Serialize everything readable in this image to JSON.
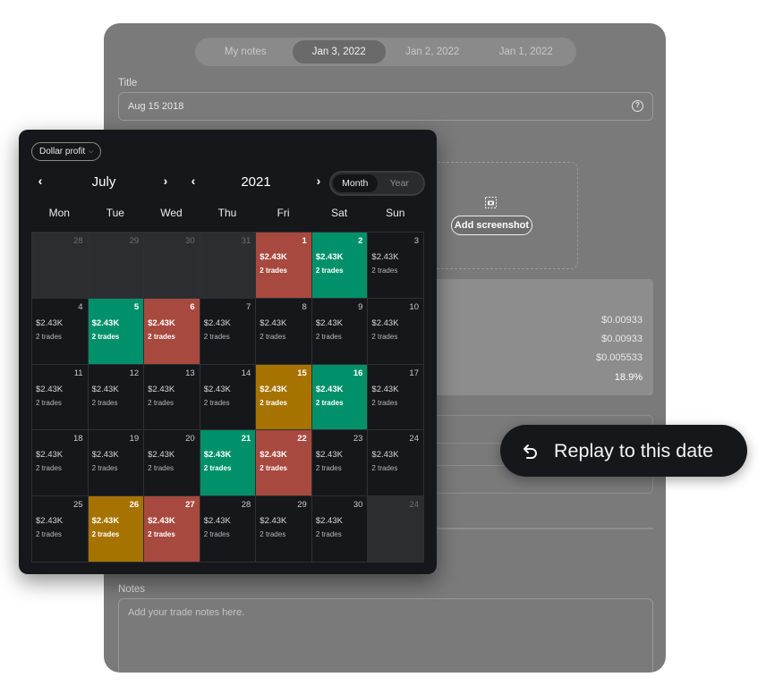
{
  "notes_panel": {
    "tabs": [
      {
        "label": "My notes",
        "active": false
      },
      {
        "label": "Jan 3, 2022",
        "active": true
      },
      {
        "label": "Jan 2, 2022",
        "active": false
      },
      {
        "label": "Jan 1, 2022",
        "active": false
      }
    ],
    "title_label": "Title",
    "title_value": "Aug 15 2018",
    "add_screenshot_label": "Add screenshot",
    "stats": [
      "$0.00933",
      "$0.00933",
      "$0.005533",
      "18.9%"
    ],
    "notes_label": "Notes",
    "notes_placeholder": "Add your trade notes here."
  },
  "calendar": {
    "metric_dropdown": "Dollar profit",
    "month": "July",
    "year": "2021",
    "view_toggle": [
      {
        "label": "Month",
        "active": true
      },
      {
        "label": "Year",
        "active": false
      }
    ],
    "weekdays": [
      "Mon",
      "Tue",
      "Wed",
      "Thu",
      "Fri",
      "Sat",
      "Sun"
    ],
    "days": [
      {
        "day": "28",
        "outside": true
      },
      {
        "day": "29",
        "outside": true
      },
      {
        "day": "30",
        "outside": true
      },
      {
        "day": "31",
        "outside": true
      },
      {
        "day": "1",
        "profit": "$2.43K",
        "trades": "2 trades",
        "status": "red"
      },
      {
        "day": "2",
        "profit": "$2.43K",
        "trades": "2 trades",
        "status": "green"
      },
      {
        "day": "3",
        "profit": "$2.43K",
        "trades": "2 trades"
      },
      {
        "day": "4",
        "profit": "$2.43K",
        "trades": "2 trades"
      },
      {
        "day": "5",
        "profit": "$2.43K",
        "trades": "2 trades",
        "status": "green"
      },
      {
        "day": "6",
        "profit": "$2.43K",
        "trades": "2 trades",
        "status": "red"
      },
      {
        "day": "7",
        "profit": "$2.43K",
        "trades": "2 trades"
      },
      {
        "day": "8",
        "profit": "$2.43K",
        "trades": "2 trades"
      },
      {
        "day": "9",
        "profit": "$2.43K",
        "trades": "2 trades"
      },
      {
        "day": "10",
        "profit": "$2.43K",
        "trades": "2 trades"
      },
      {
        "day": "11",
        "profit": "$2.43K",
        "trades": "2 trades"
      },
      {
        "day": "12",
        "profit": "$2.43K",
        "trades": "2 trades"
      },
      {
        "day": "13",
        "profit": "$2.43K",
        "trades": "2 trades"
      },
      {
        "day": "14",
        "profit": "$2.43K",
        "trades": "2 trades"
      },
      {
        "day": "15",
        "profit": "$2.43K",
        "trades": "2 trades",
        "status": "gold"
      },
      {
        "day": "16",
        "profit": "$2.43K",
        "trades": "2 trades",
        "status": "green"
      },
      {
        "day": "17",
        "profit": "$2.43K",
        "trades": "2 trades"
      },
      {
        "day": "18",
        "profit": "$2.43K",
        "trades": "2 trades"
      },
      {
        "day": "19",
        "profit": "$2.43K",
        "trades": "2 trades"
      },
      {
        "day": "20",
        "profit": "$2.43K",
        "trades": "2 trades"
      },
      {
        "day": "21",
        "profit": "$2.43K",
        "trades": "2 trades",
        "status": "green"
      },
      {
        "day": "22",
        "profit": "$2.43K",
        "trades": "2 trades",
        "status": "red"
      },
      {
        "day": "23",
        "profit": "$2.43K",
        "trades": "2 trades"
      },
      {
        "day": "24",
        "profit": "$2.43K",
        "trades": "2 trades"
      },
      {
        "day": "25",
        "profit": "$2.43K",
        "trades": "2 trades"
      },
      {
        "day": "26",
        "profit": "$2.43K",
        "trades": "2 trades",
        "status": "gold"
      },
      {
        "day": "27",
        "profit": "$2.43K",
        "trades": "2 trades",
        "status": "red"
      },
      {
        "day": "28",
        "profit": "$2.43K",
        "trades": "2 trades"
      },
      {
        "day": "29",
        "profit": "$2.43K",
        "trades": "2 trades"
      },
      {
        "day": "30",
        "profit": "$2.43K",
        "trades": "2 trades"
      },
      {
        "day": "24",
        "outside": true
      }
    ],
    "status_colors": {
      "green": "#00916a",
      "red": "#a8493f",
      "gold": "#a77300"
    }
  },
  "replay_button": {
    "label": "Replay to this date",
    "icon": "undo-arrow-icon"
  }
}
